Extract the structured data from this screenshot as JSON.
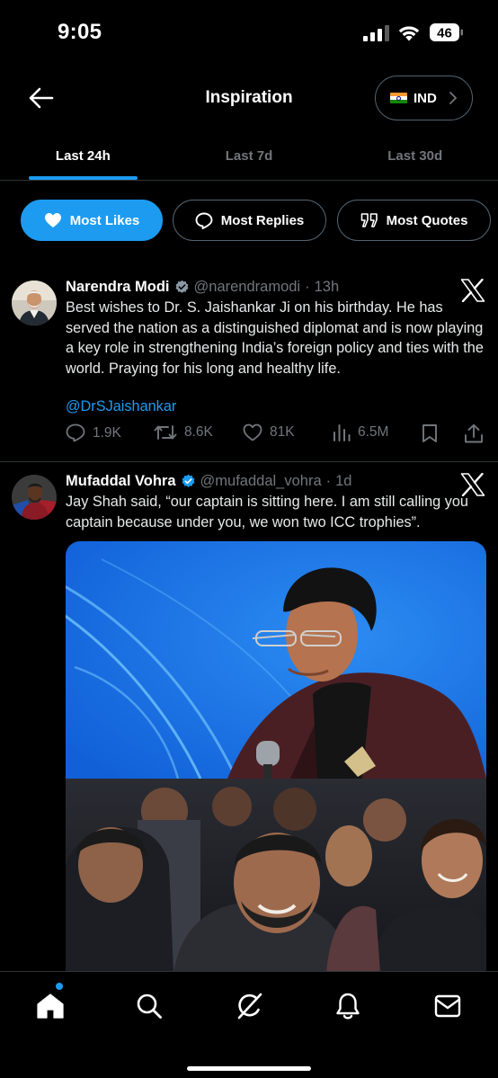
{
  "status_bar": {
    "time": "9:05",
    "battery_level": "46",
    "icons": [
      "signal-icon",
      "wifi-icon",
      "battery-icon"
    ]
  },
  "header": {
    "title": "Inspiration",
    "back_icon": "arrow-left-icon",
    "region": {
      "label": "IND",
      "flag": "india-flag-icon",
      "chevron": "chevron-right-icon"
    }
  },
  "tabs": [
    {
      "label": "Last 24h",
      "active": true
    },
    {
      "label": "Last 7d",
      "active": false
    },
    {
      "label": "Last 30d",
      "active": false
    }
  ],
  "filters": [
    {
      "label": "Most Likes",
      "icon": "heart-icon",
      "active": true
    },
    {
      "label": "Most Replies",
      "icon": "speech-bubble-icon",
      "active": false
    },
    {
      "label": "Most Quotes",
      "icon": "quote-icon",
      "active": false
    }
  ],
  "tweets": [
    {
      "name": "Narendra Modi",
      "verified": true,
      "handle": "@narendramodi",
      "separator": "·",
      "time": "13h",
      "text": "Best wishes to Dr. S. Jaishankar Ji on his birthday. He has served the nation as a distinguished diplomat and is now playing a key role in strengthening India’s foreign policy and ties with the world. Praying for his long and healthy life.",
      "mention": "@DrSJaishankar",
      "stats": {
        "replies": "1.9K",
        "reposts": "8.6K",
        "likes": "81K",
        "views": "6.5M"
      }
    },
    {
      "name": "Mufaddal Vohra",
      "verified": true,
      "handle": "@mufaddal_vohra",
      "separator": "·",
      "time": "1d",
      "text": "Jay Shah said, “our captain is sitting here. I am still calling you captain because under you, we won two ICC trophies”.",
      "media": [
        "photo-speaker-on-stage",
        "photo-audience-smiling"
      ]
    }
  ],
  "colors": {
    "background": "#000000",
    "accent": "#1d9bf0",
    "text_primary": "#e7e9ea",
    "text_secondary": "#71767b",
    "border": "#2f3336"
  },
  "bottom_nav": [
    "home-icon",
    "search-icon",
    "grok-icon",
    "notifications-bell-icon",
    "messages-envelope-icon"
  ]
}
